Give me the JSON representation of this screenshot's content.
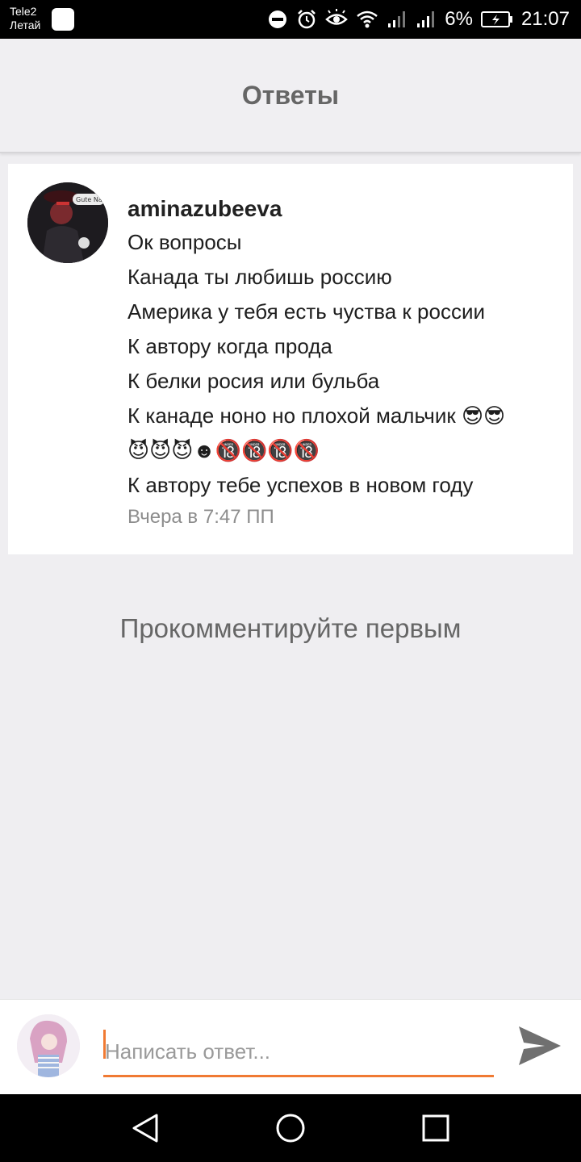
{
  "status_bar": {
    "carrier_name": "Tele2",
    "carrier_status": "Летай",
    "battery": "6%",
    "time": "21:07",
    "icons": [
      "dnd-icon",
      "alarm-icon",
      "eye-icon",
      "wifi-icon",
      "signal-icon",
      "signal-icon",
      "battery-icon"
    ]
  },
  "header": {
    "title": "Ответы"
  },
  "comment": {
    "username": "aminazubeeva",
    "lines": [
      "Ок вопросы",
      "Канада ты любишь россию",
      "Америка у тебя есть чуства к россии",
      "К автору когда прода",
      "К белки росия или бульба",
      "К канаде ноно но плохой мальчик 😎😎"
    ],
    "emoji_line": "😈😈😈☻🔞🔞🔞🔞",
    "last_line": "К автору тебе успехов в новом году",
    "timestamp": "Вчера в 7:47 ПП",
    "avatar_text": "Gute Na"
  },
  "empty_state": "Прокомментируйте первым",
  "reply": {
    "placeholder": "Написать ответ..."
  },
  "colors": {
    "accent": "#f07a33",
    "background": "#efeef1",
    "header": "#f0eff2"
  }
}
